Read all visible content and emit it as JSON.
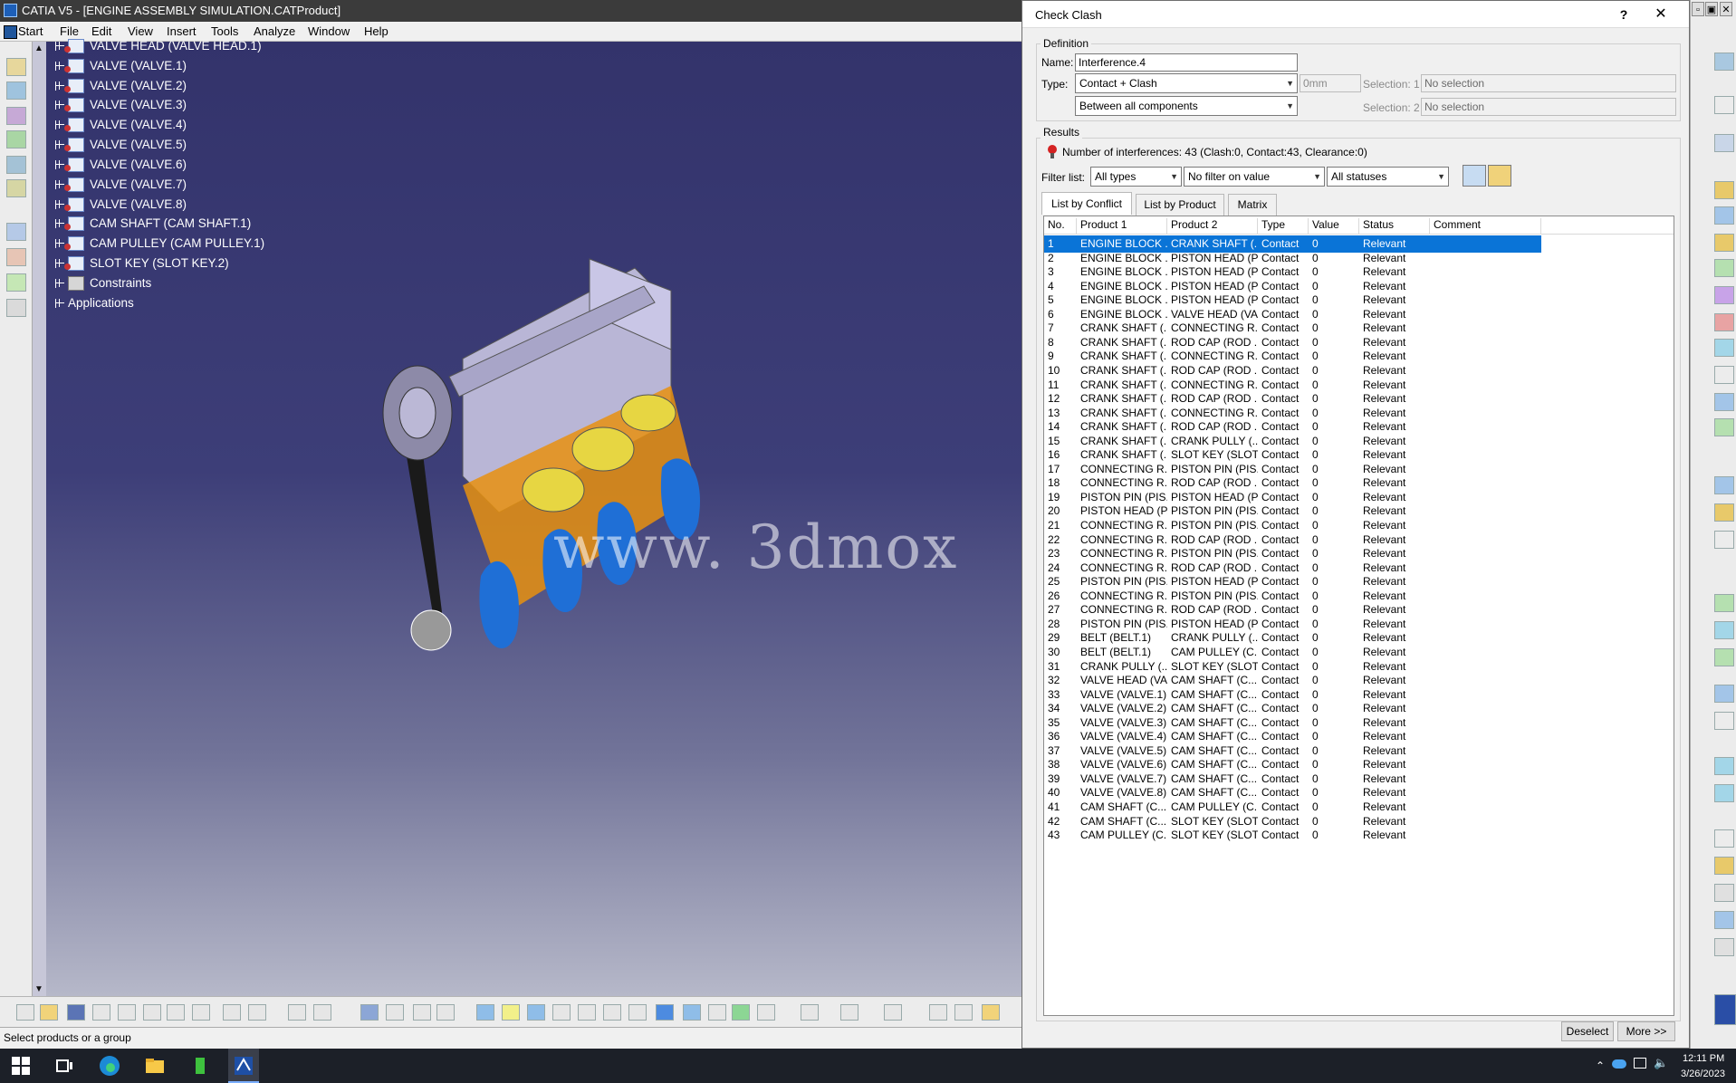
{
  "window": {
    "title": "CATIA V5 - [ENGINE ASSEMBLY SIMULATION.CATProduct]"
  },
  "menu": [
    "Start",
    "File",
    "Edit",
    "View",
    "Insert",
    "Tools",
    "Analyze",
    "Window",
    "Help"
  ],
  "tree": [
    {
      "label": "VALVE HEAD (VALVE HEAD.1)"
    },
    {
      "label": "VALVE (VALVE.1)"
    },
    {
      "label": "VALVE (VALVE.2)"
    },
    {
      "label": "VALVE (VALVE.3)"
    },
    {
      "label": "VALVE (VALVE.4)"
    },
    {
      "label": "VALVE (VALVE.5)"
    },
    {
      "label": "VALVE (VALVE.6)"
    },
    {
      "label": "VALVE (VALVE.7)"
    },
    {
      "label": "VALVE (VALVE.8)"
    },
    {
      "label": "CAM SHAFT (CAM SHAFT.1)"
    },
    {
      "label": "CAM PULLEY (CAM PULLEY.1)"
    },
    {
      "label": "SLOT KEY (SLOT KEY.2)"
    },
    {
      "label": "Constraints"
    },
    {
      "label": "Applications"
    }
  ],
  "watermark": "www. 3dmox",
  "status_text": "Select products or a group",
  "dialog": {
    "title": "Check Clash",
    "help": "?",
    "close": "✕",
    "definition": {
      "group_label": "Definition",
      "name_label": "Name:",
      "name_value": "Interference.4",
      "type_label": "Type:",
      "type_value": "Contact + Clash",
      "clearance_value": "0mm",
      "scope_value": "Between all components",
      "selection1_label": "Selection: 1",
      "selection1_value": "No selection",
      "selection2_label": "Selection: 2",
      "selection2_value": "No selection"
    },
    "results": {
      "group_label": "Results",
      "summary": "Number of interferences: 43 (Clash:0, Contact:43, Clearance:0)",
      "filter_label": "Filter list:",
      "filter_type": "All types",
      "filter_value": "No filter on value",
      "filter_status": "All statuses"
    },
    "tabs": [
      "List by Conflict",
      "List by Product",
      "Matrix"
    ],
    "columns": [
      "No.",
      "Product 1",
      "Product 2",
      "Type",
      "Value",
      "Status",
      "Comment"
    ],
    "rows": [
      [
        "1",
        "ENGINE BLOCK ...",
        "CRANK SHAFT (...",
        "Contact",
        "0",
        "Relevant"
      ],
      [
        "2",
        "ENGINE BLOCK ...",
        "PISTON HEAD (P...",
        "Contact",
        "0",
        "Relevant"
      ],
      [
        "3",
        "ENGINE BLOCK ...",
        "PISTON HEAD (P...",
        "Contact",
        "0",
        "Relevant"
      ],
      [
        "4",
        "ENGINE BLOCK ...",
        "PISTON HEAD (P...",
        "Contact",
        "0",
        "Relevant"
      ],
      [
        "5",
        "ENGINE BLOCK ...",
        "PISTON HEAD (P...",
        "Contact",
        "0",
        "Relevant"
      ],
      [
        "6",
        "ENGINE BLOCK ...",
        "VALVE HEAD (VA...",
        "Contact",
        "0",
        "Relevant"
      ],
      [
        "7",
        "CRANK SHAFT (...",
        "CONNECTING R...",
        "Contact",
        "0",
        "Relevant"
      ],
      [
        "8",
        "CRANK SHAFT (...",
        "ROD CAP (ROD ...",
        "Contact",
        "0",
        "Relevant"
      ],
      [
        "9",
        "CRANK SHAFT (...",
        "CONNECTING R...",
        "Contact",
        "0",
        "Relevant"
      ],
      [
        "10",
        "CRANK SHAFT (...",
        "ROD CAP (ROD ...",
        "Contact",
        "0",
        "Relevant"
      ],
      [
        "11",
        "CRANK SHAFT (...",
        "CONNECTING R...",
        "Contact",
        "0",
        "Relevant"
      ],
      [
        "12",
        "CRANK SHAFT (...",
        "ROD CAP (ROD ...",
        "Contact",
        "0",
        "Relevant"
      ],
      [
        "13",
        "CRANK SHAFT (...",
        "CONNECTING R...",
        "Contact",
        "0",
        "Relevant"
      ],
      [
        "14",
        "CRANK SHAFT (...",
        "ROD CAP (ROD ...",
        "Contact",
        "0",
        "Relevant"
      ],
      [
        "15",
        "CRANK SHAFT (...",
        "CRANK PULLY (...",
        "Contact",
        "0",
        "Relevant"
      ],
      [
        "16",
        "CRANK SHAFT (...",
        "SLOT KEY (SLOT ...",
        "Contact",
        "0",
        "Relevant"
      ],
      [
        "17",
        "CONNECTING R...",
        "PISTON PIN (PIS...",
        "Contact",
        "0",
        "Relevant"
      ],
      [
        "18",
        "CONNECTING R...",
        "ROD CAP (ROD ...",
        "Contact",
        "0",
        "Relevant"
      ],
      [
        "19",
        "PISTON PIN (PIS...",
        "PISTON HEAD (P...",
        "Contact",
        "0",
        "Relevant"
      ],
      [
        "20",
        "PISTON HEAD (P...",
        "PISTON PIN (PIS...",
        "Contact",
        "0",
        "Relevant"
      ],
      [
        "21",
        "CONNECTING R...",
        "PISTON PIN (PIS...",
        "Contact",
        "0",
        "Relevant"
      ],
      [
        "22",
        "CONNECTING R...",
        "ROD CAP (ROD ...",
        "Contact",
        "0",
        "Relevant"
      ],
      [
        "23",
        "CONNECTING R...",
        "PISTON PIN (PIS...",
        "Contact",
        "0",
        "Relevant"
      ],
      [
        "24",
        "CONNECTING R...",
        "ROD CAP (ROD ...",
        "Contact",
        "0",
        "Relevant"
      ],
      [
        "25",
        "PISTON PIN (PIS...",
        "PISTON HEAD (P...",
        "Contact",
        "0",
        "Relevant"
      ],
      [
        "26",
        "CONNECTING R...",
        "PISTON PIN (PIS...",
        "Contact",
        "0",
        "Relevant"
      ],
      [
        "27",
        "CONNECTING R...",
        "ROD CAP (ROD ...",
        "Contact",
        "0",
        "Relevant"
      ],
      [
        "28",
        "PISTON PIN (PIS...",
        "PISTON HEAD (P...",
        "Contact",
        "0",
        "Relevant"
      ],
      [
        "29",
        "BELT (BELT.1)",
        "CRANK PULLY (...",
        "Contact",
        "0",
        "Relevant"
      ],
      [
        "30",
        "BELT (BELT.1)",
        "CAM PULLEY (C...",
        "Contact",
        "0",
        "Relevant"
      ],
      [
        "31",
        "CRANK PULLY (...",
        "SLOT KEY (SLOT ...",
        "Contact",
        "0",
        "Relevant"
      ],
      [
        "32",
        "VALVE HEAD (VA...",
        "CAM SHAFT (C...",
        "Contact",
        "0",
        "Relevant"
      ],
      [
        "33",
        "VALVE (VALVE.1)",
        "CAM SHAFT (C...",
        "Contact",
        "0",
        "Relevant"
      ],
      [
        "34",
        "VALVE (VALVE.2)",
        "CAM SHAFT (C...",
        "Contact",
        "0",
        "Relevant"
      ],
      [
        "35",
        "VALVE (VALVE.3)",
        "CAM SHAFT (C...",
        "Contact",
        "0",
        "Relevant"
      ],
      [
        "36",
        "VALVE (VALVE.4)",
        "CAM SHAFT (C...",
        "Contact",
        "0",
        "Relevant"
      ],
      [
        "37",
        "VALVE (VALVE.5)",
        "CAM SHAFT (C...",
        "Contact",
        "0",
        "Relevant"
      ],
      [
        "38",
        "VALVE (VALVE.6)",
        "CAM SHAFT (C...",
        "Contact",
        "0",
        "Relevant"
      ],
      [
        "39",
        "VALVE (VALVE.7)",
        "CAM SHAFT (C...",
        "Contact",
        "0",
        "Relevant"
      ],
      [
        "40",
        "VALVE (VALVE.8)",
        "CAM SHAFT (C...",
        "Contact",
        "0",
        "Relevant"
      ],
      [
        "41",
        "CAM SHAFT (C...",
        "CAM PULLEY (C...",
        "Contact",
        "0",
        "Relevant"
      ],
      [
        "42",
        "CAM SHAFT (C...",
        "SLOT KEY (SLOT ...",
        "Contact",
        "0",
        "Relevant"
      ],
      [
        "43",
        "CAM PULLEY (C...",
        "SLOT KEY (SLOT ...",
        "Contact",
        "0",
        "Relevant"
      ]
    ],
    "buttons": {
      "deselect": "Deselect",
      "more": "More >>"
    }
  },
  "taskbar": {
    "time": "12:11 PM",
    "date": "3/26/2023"
  },
  "colors": {
    "selection": "#0a74d7",
    "viewport_top": "#33336b",
    "viewport_bottom": "#b6b8c9"
  }
}
